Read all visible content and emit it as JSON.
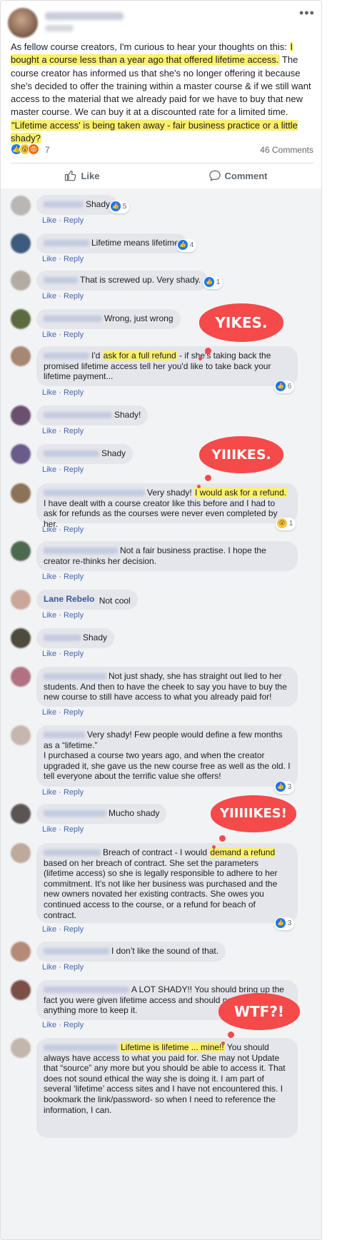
{
  "post": {
    "more_icon": "more-dots-icon",
    "text_parts": [
      "As fellow course creators, I'm curious to hear your thoughts on this: ",
      "I bought a course less than a year ago that offered lifetime access.",
      " The course creator has informed us that she's no longer offering it because she's decided to offer the training within a master course & if we still want access to the material that we already paid for we have to buy that new master course. We can buy it at a discounted rate for a limited time. ",
      "\"Lifetime access' is being taken away - fair business practice or a little shady?"
    ],
    "reaction_count": "7",
    "comment_count": "46 Comments",
    "like_label": "Like",
    "comment_label": "Comment"
  },
  "actions": {
    "like": "Like",
    "reply": "Reply",
    "sep": " · "
  },
  "comments": [
    {
      "text": "Shady",
      "likes": "5"
    },
    {
      "text": "Lifetime means lifetime",
      "likes": "4"
    },
    {
      "text": "That is screwed up. Very shady.",
      "likes": "1"
    },
    {
      "text": "Wrong, just wrong"
    },
    {
      "pre": "I'd ",
      "hl": "ask for a full refund",
      "post": " - if she's taking back the promised lifetime access tell her you'd like to take back your lifetime payment...",
      "likes": "6"
    },
    {
      "text": "Shady!"
    },
    {
      "text": "Shady"
    },
    {
      "pre": "Very shady! ",
      "hl": "I would ask for a refund.",
      "post": " I have dealt with a course creator like this before and I had to ask for refunds as the courses were never even completed by her.",
      "wow": "1"
    },
    {
      "text": "Not a fair business practise. I hope the creator re-thinks her decision."
    },
    {
      "name": "Lane Rebelo",
      "text": "Not cool"
    },
    {
      "text": "Shady"
    },
    {
      "text": "Not just shady, she has straight out lied to her students. And then to have the cheek to say you have to buy the new course to still have access to what you already paid for!"
    },
    {
      "text": "Very shady! Few people would define a few months as a “lifetime.”\nI purchased a course two years ago, and when the creator upgraded it, she gave us the new course free as well as the old. I tell everyone about the terrific value she offers!",
      "likes": "3"
    },
    {
      "text": "Mucho shady"
    },
    {
      "pre": "Breach of contract - I would ",
      "hl": "demand a refund",
      "post": " based on her breach of contract. She set the parameters (lifetime access) so she is legally responsible to adhere to her commitment. It’s not like her business was purchased and the new owners novated her existing contracts. She owes you continued access to the course, or a refund for beach of contract.",
      "likes": "3"
    },
    {
      "text": "I don’t like the sound of that."
    },
    {
      "text": "A LOT SHADY!! You should bring up the fact you were given lifetime access and should not have to pay anything more to keep it."
    },
    {
      "hl": "Lifetime is lifetime ... mine!!",
      "post": " You should always have access to what you paid for. She may not Update that “source” any more but you should be able to access it. That does not sound ethical the way she is doing it. I am part of several ‘lifetime’ access sites and I have not encountered this. I bookmark the link/password- so when I need to reference the information, I can."
    }
  ],
  "callouts": [
    "YIKES.",
    "YIIIKES.",
    "YIIIIIKES!",
    "WTF?!"
  ],
  "colors": {
    "highlight": "#fdf06b",
    "callout": "#f44a4a",
    "link": "#4267b2",
    "bubble": "#e4e6eb"
  }
}
